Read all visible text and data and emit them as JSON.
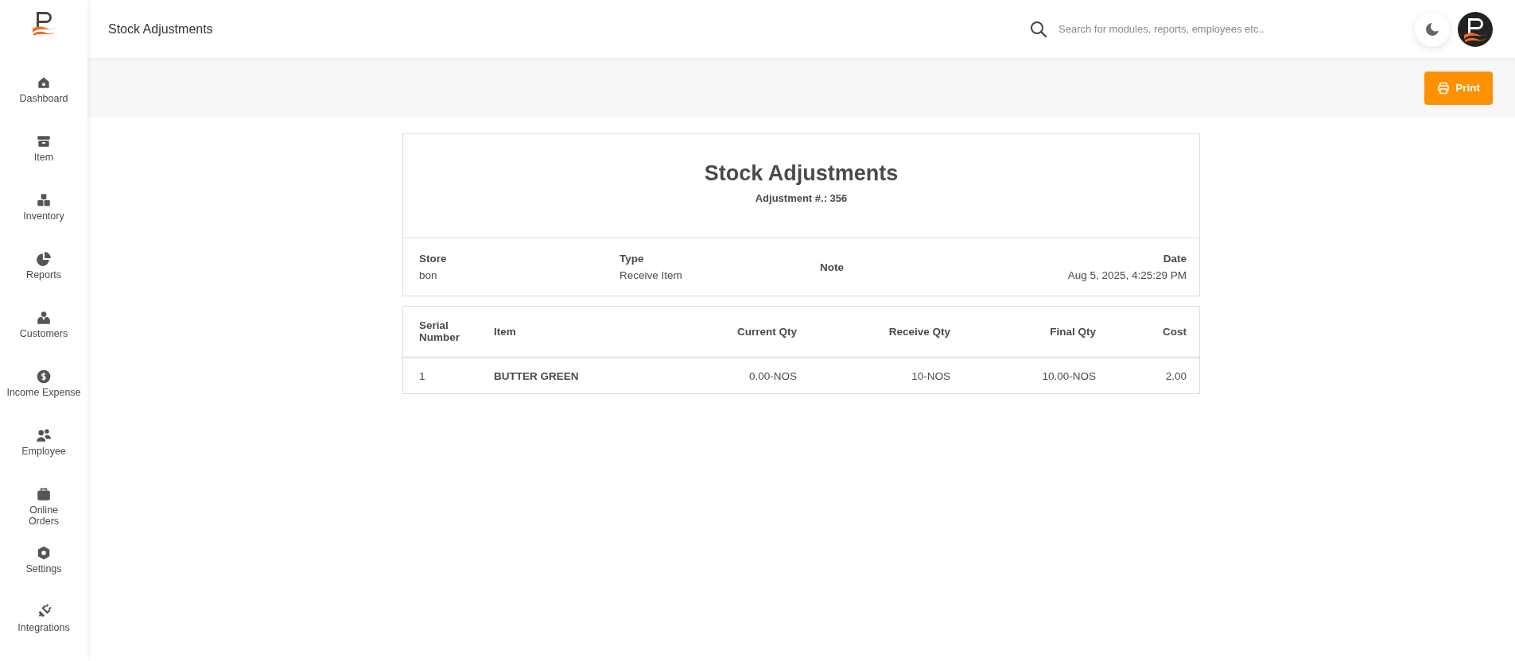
{
  "sidebar": {
    "items": [
      {
        "label": "Dashboard"
      },
      {
        "label": "Item"
      },
      {
        "label": "Inventory"
      },
      {
        "label": "Reports"
      },
      {
        "label": "Customers"
      },
      {
        "label": "Income Expense"
      },
      {
        "label": "Employee"
      },
      {
        "label": "Online Orders"
      },
      {
        "label": "Settings"
      },
      {
        "label": "Integrations"
      }
    ]
  },
  "header": {
    "title": "Stock Adjustments",
    "search": {
      "placeholder": "Search for modules, reports, employees etc.."
    }
  },
  "toolbar": {
    "print_button": "Print"
  },
  "report": {
    "title": "Stock Adjustments",
    "subtitle": "Adjustment #.: 356",
    "info": [
      {
        "label": "Store",
        "value": "bon"
      },
      {
        "label": "Type",
        "value": "Receive Item"
      },
      {
        "label": "Note"
      },
      {
        "label": "Date",
        "value": "Aug 5, 2025, 4:25:29 PM"
      }
    ],
    "table": {
      "columns": [
        "Serial Number",
        "Item",
        "Current Qty",
        "Receive Qty",
        "Final Qty",
        "Cost"
      ],
      "rows": [
        [
          "1",
          "BUTTER GREEN",
          "0.00-NOS",
          "10-NOS",
          "10.00-NOS",
          "2.00"
        ]
      ]
    }
  }
}
